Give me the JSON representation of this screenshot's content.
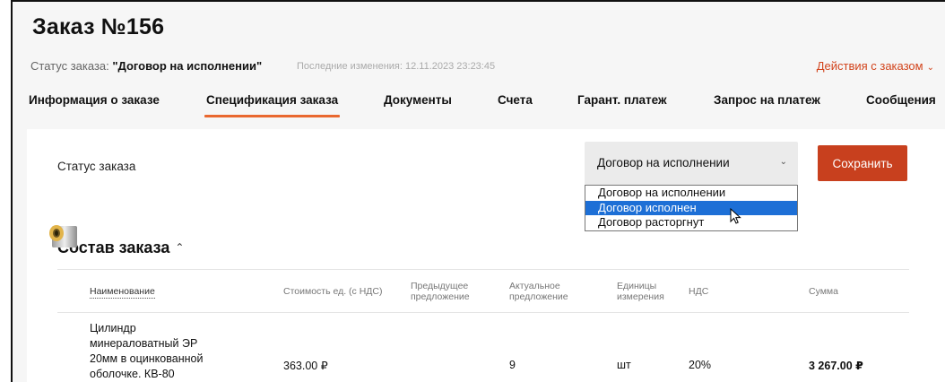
{
  "order": {
    "title": "Заказ №156",
    "status_prefix": "Статус заказа: ",
    "status_value": "\"Договор на исполнении\"",
    "last_changes": "Последние изменения: 12.11.2023 23:23:45",
    "actions_label": "Действия с заказом",
    "actions_icon": "chevron-down-icon"
  },
  "tabs": [
    {
      "label": "Информация о заказе",
      "active": false
    },
    {
      "label": "Спецификация заказа",
      "active": true
    },
    {
      "label": "Документы",
      "active": false
    },
    {
      "label": "Счета",
      "active": false
    },
    {
      "label": "Гарант. платеж",
      "active": false
    },
    {
      "label": "Запрос на платеж",
      "active": false
    },
    {
      "label": "Сообщения",
      "active": false
    }
  ],
  "status_form": {
    "label": "Статус заказа",
    "selected": "Договор на исполнении",
    "options": [
      "Договор на исполнении",
      "Договор исполнен",
      "Договор расторгнут"
    ],
    "highlighted_option": "Договор исполнен",
    "save_label": "Сохранить"
  },
  "composition": {
    "title": "Состав заказа",
    "caret": "^",
    "columns": {
      "name": "Наименование",
      "unit_price": "Стоимость ед. (с НДС)",
      "prev_offer": "Предыдущее предложение",
      "actual_offer": "Актуальное предложение",
      "units": "Единицы измерения",
      "vat": "НДС",
      "sum": "Сумма"
    },
    "rows": [
      {
        "name": "Цилиндр минераловатный ЭР 20мм в оцинкованной оболочке. КВ-80",
        "unit_price": "363.00 ₽",
        "prev_offer": "",
        "actual_offer": "9",
        "units": "шт",
        "vat": "20%",
        "sum": "3 267.00 ₽"
      }
    ]
  },
  "colors": {
    "accent": "#c8401e",
    "tab_underline": "#e9682f",
    "link": "#d2441c",
    "highlight": "#1d6fd6"
  }
}
